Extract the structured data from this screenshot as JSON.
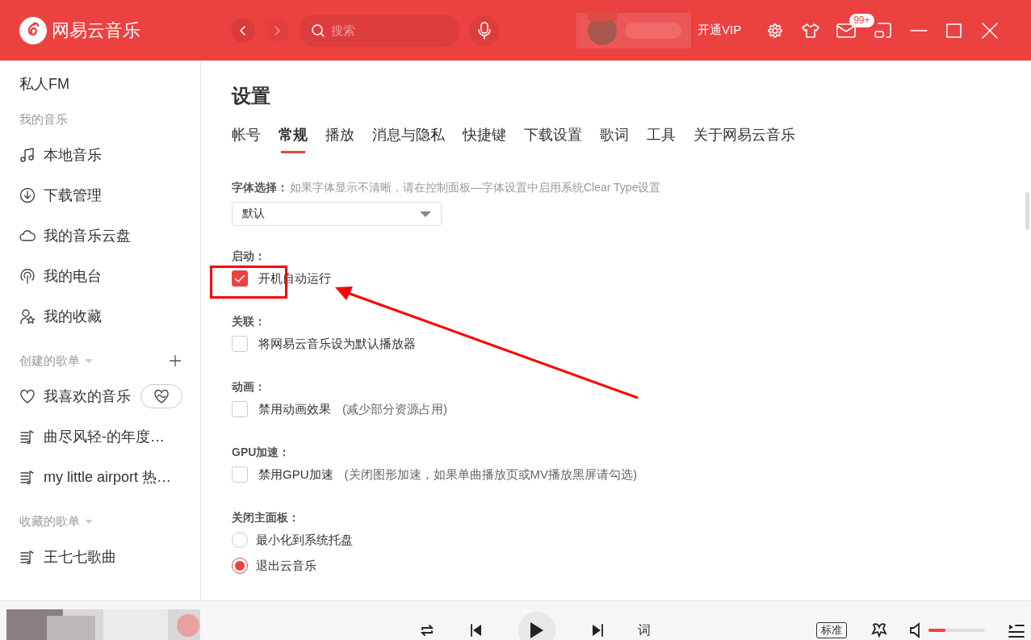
{
  "app": {
    "name": "网易云音乐"
  },
  "topbar": {
    "search_placeholder": "搜索",
    "vip": "开通VIP",
    "mail_badge": "99+"
  },
  "sidebar": {
    "fm": "私人FM",
    "sections": [
      {
        "title": "我的音乐",
        "collapsible": false,
        "addable": false,
        "items": [
          {
            "kind": "note",
            "label": "本地音乐"
          },
          {
            "kind": "download",
            "label": "下载管理"
          },
          {
            "kind": "cloud",
            "label": "我的音乐云盘"
          },
          {
            "kind": "radio",
            "label": "我的电台"
          },
          {
            "kind": "collect",
            "label": "我的收藏"
          }
        ]
      },
      {
        "title": "创建的歌单",
        "collapsible": true,
        "addable": true,
        "items": [
          {
            "kind": "heart",
            "label": "我喜欢的音乐"
          },
          {
            "kind": "playlist",
            "label": "曲尽风轻-的年度…"
          },
          {
            "kind": "playlist",
            "label": "my little airport 热…"
          }
        ]
      },
      {
        "title": "收藏的歌单",
        "collapsible": true,
        "addable": false,
        "items": [
          {
            "kind": "playlist",
            "label": "王七七歌曲"
          }
        ]
      }
    ]
  },
  "settings": {
    "title": "设置",
    "tabs": [
      {
        "label": "帐号",
        "selected": false
      },
      {
        "label": "常规",
        "selected": true
      },
      {
        "label": "播放",
        "selected": false
      },
      {
        "label": "消息与隐私",
        "selected": false
      },
      {
        "label": "快捷键",
        "selected": false
      },
      {
        "label": "下载设置",
        "selected": false
      },
      {
        "label": "歌词",
        "selected": false
      },
      {
        "label": "工具",
        "selected": false
      },
      {
        "label": "关于网易云音乐",
        "selected": false
      }
    ],
    "font": {
      "label": "字体选择：",
      "hint": "如果字体显示不清晰，请在控制面板—字体设置中启用系统Clear Type设置",
      "value": "默认"
    },
    "groups": [
      {
        "title": "启动：",
        "options": [
          {
            "kind": "checkbox",
            "label": "开机自动运行",
            "checked": true
          }
        ]
      },
      {
        "title": "关联：",
        "options": [
          {
            "kind": "checkbox",
            "label": "将网易云音乐设为默认播放器",
            "checked": false
          }
        ]
      },
      {
        "title": "动画：",
        "options": [
          {
            "kind": "checkbox",
            "label": "禁用动画效果",
            "note": "(减少部分资源占用)",
            "checked": false
          }
        ]
      },
      {
        "title": "GPU加速：",
        "options": [
          {
            "kind": "checkbox",
            "label": "禁用GPU加速",
            "note": "(关闭图形加速，如果单曲播放页或MV播放黑屏请勾选)",
            "checked": false
          }
        ]
      },
      {
        "title": "关闭主面板：",
        "options": [
          {
            "kind": "radio",
            "label": "最小化到系统托盘",
            "selected": false
          },
          {
            "kind": "radio",
            "label": "退出云音乐",
            "selected": true
          }
        ]
      }
    ]
  },
  "player": {
    "lyrics": "词",
    "quality": "标准",
    "volume": {
      "level": 0.3
    }
  }
}
